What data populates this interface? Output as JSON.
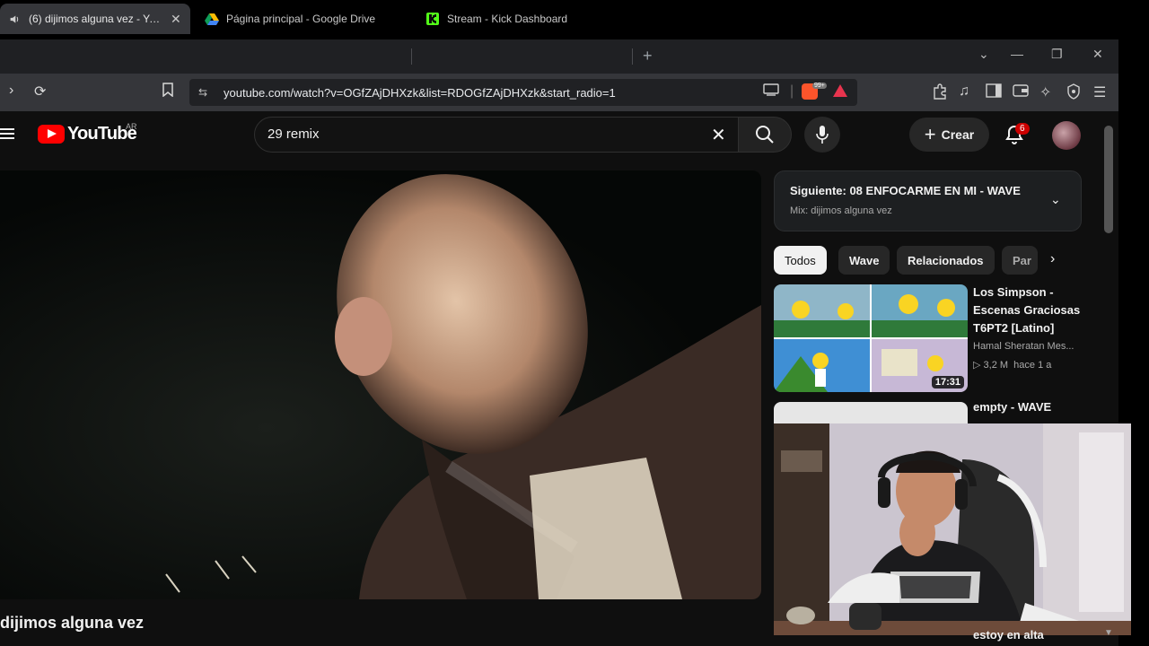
{
  "browser": {
    "tabs": [
      {
        "label": "(6) dijimos alguna vez - YouTube",
        "active": true
      },
      {
        "label": "Página principal - Google Drive",
        "active": false
      },
      {
        "label": "Stream - Kick Dashboard",
        "active": false
      }
    ],
    "url": "youtube.com/watch?v=OGfZAjDHXzk&list=RDOGfZAjDHXzk&start_radio=1",
    "rewards_badge": "99+"
  },
  "youtube": {
    "logo_text": "YouTube",
    "country_code": "AR",
    "search": {
      "value": "29 remix"
    },
    "create_label": "Crear",
    "notification_count": "6",
    "video_title": "dijimos alguna vez",
    "up_next": {
      "title": "Siguiente: 08 ENFOCARME EN MI - WAVE",
      "subtitle": "Mix: dijimos alguna vez"
    },
    "chips": [
      "Todos",
      "Wave",
      "Relacionados",
      "Par"
    ],
    "recommendations": [
      {
        "title": "Los Simpson - Escenas Graciosas T6PT2 [Latino]",
        "channel": "Hamal Sheratan Mes...",
        "views": "3,2 M",
        "age": "hace 1 a",
        "duration": "17:31"
      },
      {
        "title": "empty - WAVE"
      },
      {
        "title": "estoy en alta"
      }
    ]
  },
  "colors": {
    "yt_bg": "#0f0f0f",
    "yt_red": "#ff0000",
    "brave_orange": "#fb542b",
    "notif_red": "#cc0000"
  }
}
